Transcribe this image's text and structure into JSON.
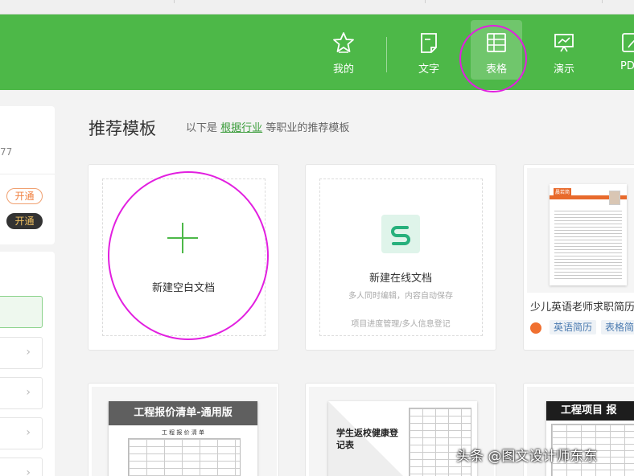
{
  "nav": {
    "items": [
      {
        "label": "我的",
        "icon": "star-icon"
      },
      {
        "label": "文字",
        "icon": "document-icon"
      },
      {
        "label": "表格",
        "icon": "spreadsheet-icon"
      },
      {
        "label": "演示",
        "icon": "presentation-icon"
      },
      {
        "label": "PD",
        "icon": "pdf-icon"
      }
    ],
    "active": "表格"
  },
  "sidebar": {
    "number_fragment": "77",
    "pill_outline": "开通",
    "pill_dark": "开通"
  },
  "main": {
    "heading": "推荐模板",
    "sub_prefix": "以下是",
    "sub_link": "根据行业",
    "sub_suffix": "等职业的推荐模板"
  },
  "cards": {
    "blank": {
      "title": "新建空白文档"
    },
    "online": {
      "title": "新建在线文档",
      "desc": "多人同时编辑，内容自动保存",
      "examples": "项目进度管理/多人信息登记"
    },
    "resume": {
      "title": "少儿英语老师求职简历",
      "tags": [
        "英语简历",
        "表格简"
      ],
      "resume_name": "晨若简"
    },
    "row2": [
      {
        "header": "工程报价清单-通用版",
        "sub": "工 程 报 价 清 单"
      },
      {
        "header": "学生返校健康登记表"
      },
      {
        "header": "工程项目 报"
      }
    ]
  },
  "watermark": "头条 @图文设计师东东",
  "colors": {
    "brand_green": "#4db848",
    "annotation_magenta": "#e21fe0"
  }
}
